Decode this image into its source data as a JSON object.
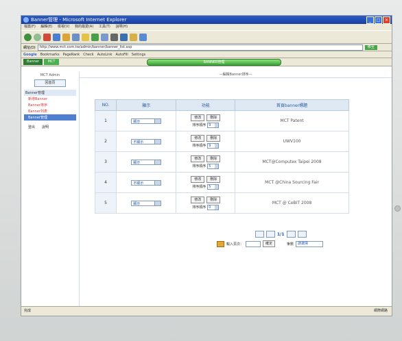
{
  "window": {
    "title": "Banner管理 - Microsoft Internet Explorer"
  },
  "menu": [
    "檔案(F)",
    "編輯(E)",
    "檢視(V)",
    "我的最愛(A)",
    "工具(T)",
    "說明(H)"
  ],
  "address": {
    "label": "網址(D)",
    "value": "http://www.mct.com.tw/admin/banner/banner_list.asp",
    "go_label": "移至"
  },
  "links": {
    "google": "Google",
    "items": [
      "Bookmarks",
      "PageRank",
      "Check",
      "AutoLink",
      "AutoFill",
      "Settings"
    ]
  },
  "nav": {
    "brand": "Banner",
    "brand2": "MCT",
    "banner_text": "BANNER管理"
  },
  "sidebar": {
    "header": "MCT Admin",
    "button_label": "回首頁",
    "group_title": "Banner管理",
    "items": [
      "新增Banner",
      "Banner排序",
      "Banner列表"
    ],
    "selected": "Banner管理",
    "bottom": [
      "登出",
      "說明"
    ]
  },
  "main": {
    "header": "—編輯Banner排序—",
    "columns": [
      "NO.",
      "顯示",
      "功能",
      "首頁banner標題"
    ],
    "rows": [
      {
        "no": "1",
        "display": "顯示",
        "order": "9",
        "title": "MCT Patent"
      },
      {
        "no": "2",
        "display": "不顯示",
        "order": "9",
        "title": "UWV100"
      },
      {
        "no": "3",
        "display": "顯示",
        "order": "5",
        "title": "MCT@Computex Taipei 2008"
      },
      {
        "no": "4",
        "display": "不顯示",
        "order": "5",
        "title": "MCT @China Sourcing Fair"
      },
      {
        "no": "5",
        "display": "顯示",
        "order": "0",
        "title": "MCT @ CeBIT 2008"
      }
    ],
    "edit_label": "修改",
    "delete_label": "刪除",
    "order_label": "排序順序"
  },
  "pager": {
    "text": "1/1",
    "jump_label": "輸入頁次：",
    "confirm_label": "確定",
    "per_page_label": "筆數",
    "per_page_value": "請選擇"
  },
  "status": {
    "done": "完成",
    "zone": "網際網路"
  }
}
